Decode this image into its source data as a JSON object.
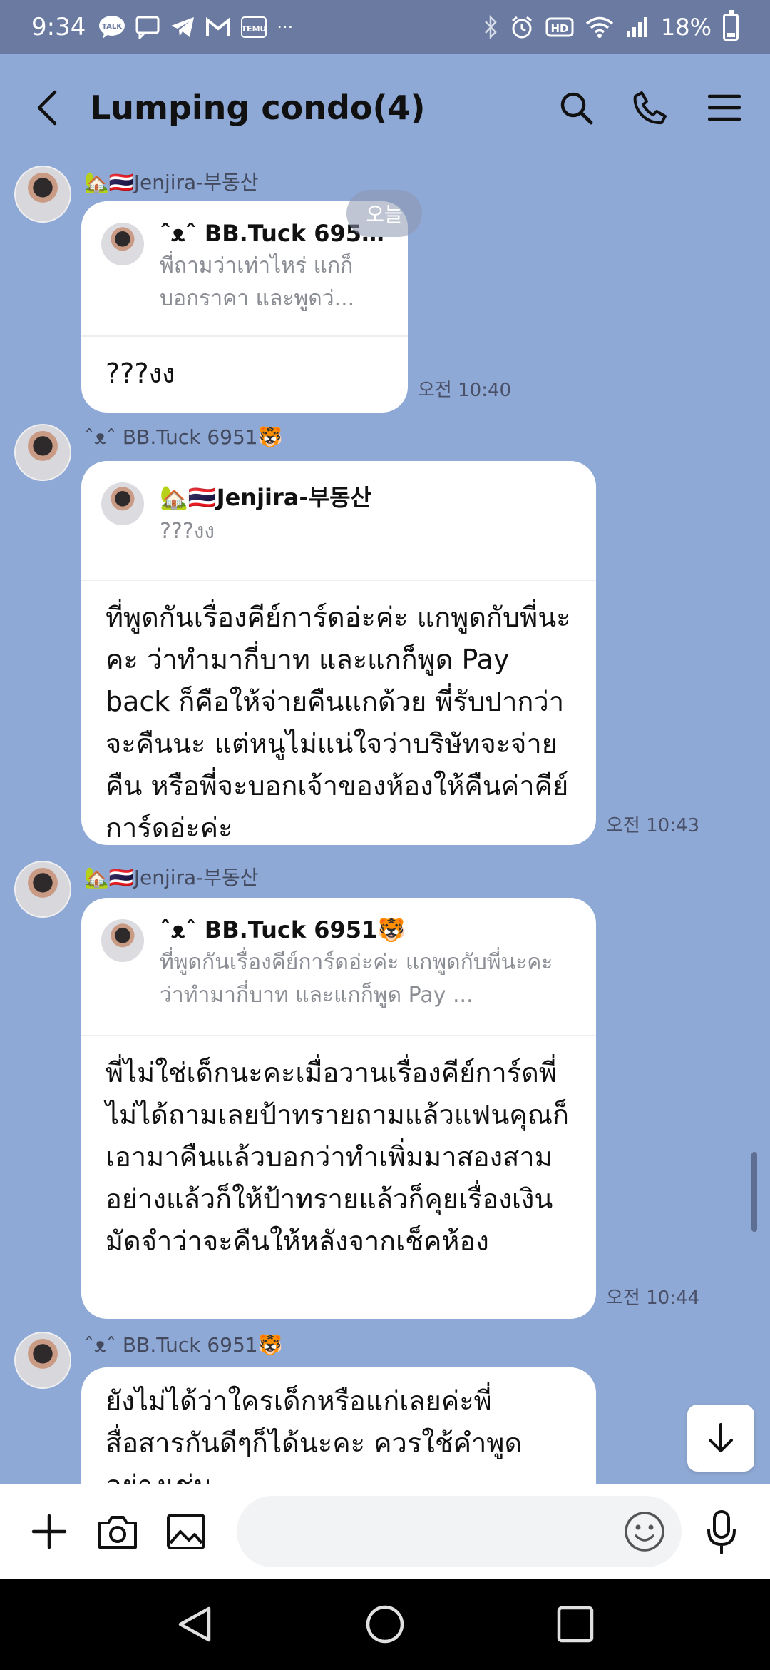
{
  "status_bar": {
    "time": "9:34",
    "battery": "18%",
    "battery_level": 0.18,
    "notification_icons": [
      "talk-icon",
      "chat-icon",
      "telegram-icon",
      "gmail-icon",
      "temu-icon",
      "more-icon"
    ],
    "temu_label": "TEMU",
    "more": "···",
    "system_icons": [
      "bluetooth-icon",
      "alarm-icon",
      "hd-icon",
      "wifi-icon",
      "signal-icon",
      "battery-icon"
    ],
    "hd_label": "HD"
  },
  "header": {
    "title": "Lumping condo(4)",
    "icons": [
      "back-icon",
      "search-icon",
      "call-icon",
      "menu-icon"
    ]
  },
  "date_pill": "오늘",
  "messages": [
    {
      "sender": "🏡🇹🇭Jenjira-부동산",
      "quote_name": "ˆᴥˆ BB.Tuck 6951...",
      "quote_text": "พี่ถามว่าเท่าไหร่ แกก็บอกราคา และพูดว่...",
      "text": "???งง",
      "time": "오전 10:40"
    },
    {
      "sender": "ˆᴥˆ BB.Tuck 6951🐯",
      "quote_name": "🏡🇹🇭Jenjira-부동산",
      "quote_text": "???งง",
      "text": "ที่พูดกันเรื่องคีย์การ์ดอ่ะค่ะ แกพูดกับพี่นะคะ ว่าทำมากี่บาท และแกก็พูด Pay back ก็คือให้จ่ายคืนแกด้วย พี่รับปากว่าจะคืนนะ แต่หนูไม่แน่ใจว่าบริษัทจะจ่ายคืน หรือพี่จะบอกเจ้าของห้องให้คืนค่าคีย์การ์ดอ่ะค่ะ",
      "time": "오전 10:43"
    },
    {
      "sender": "🏡🇹🇭Jenjira-부동산",
      "quote_name": "ˆᴥˆ BB.Tuck 6951🐯",
      "quote_text": "ที่พูดกันเรื่องคีย์การ์ดอ่ะค่ะ แกพูดกับพี่นะคะ ว่าทำมากี่บาท และแกก็พูด Pay ...",
      "text": "พี่ไม่ใช่เด็กนะคะเมื่อวานเรื่องคีย์การ์ดพี่ไม่ได้ถามเลยป้าทรายถามแล้วแฟนคุณก็เอามาคืนแล้วบอกว่าทำเพิ่มมาสองสามอย่างแล้วก็ให้ป้าทรายแล้วก็คุยเรื่องเงินมัดจำว่าจะคืนให้หลังจากเช็คห้อง",
      "time": "오전 10:44"
    },
    {
      "sender": "ˆᴥˆ BB.Tuck 6951🐯",
      "text": "ยังไม่ได้ว่าใครเด็กหรือแก่เลยค่ะพี่ สื่อสารกันดีๆก็ได้นะคะ ควรใช้คำพูดอย่างเช่น",
      "time": ""
    }
  ],
  "input_bar": {
    "placeholder": "",
    "icons": [
      "plus-icon",
      "camera-icon",
      "image-icon",
      "emoji-icon",
      "mic-icon"
    ]
  },
  "nav_bar": {
    "icons": [
      "nav-back-icon",
      "nav-home-icon",
      "nav-recents-icon"
    ]
  },
  "colors": {
    "chat_background": "#8fa9d6",
    "status_bar": "#6a7aa0",
    "bubble": "#ffffff"
  }
}
